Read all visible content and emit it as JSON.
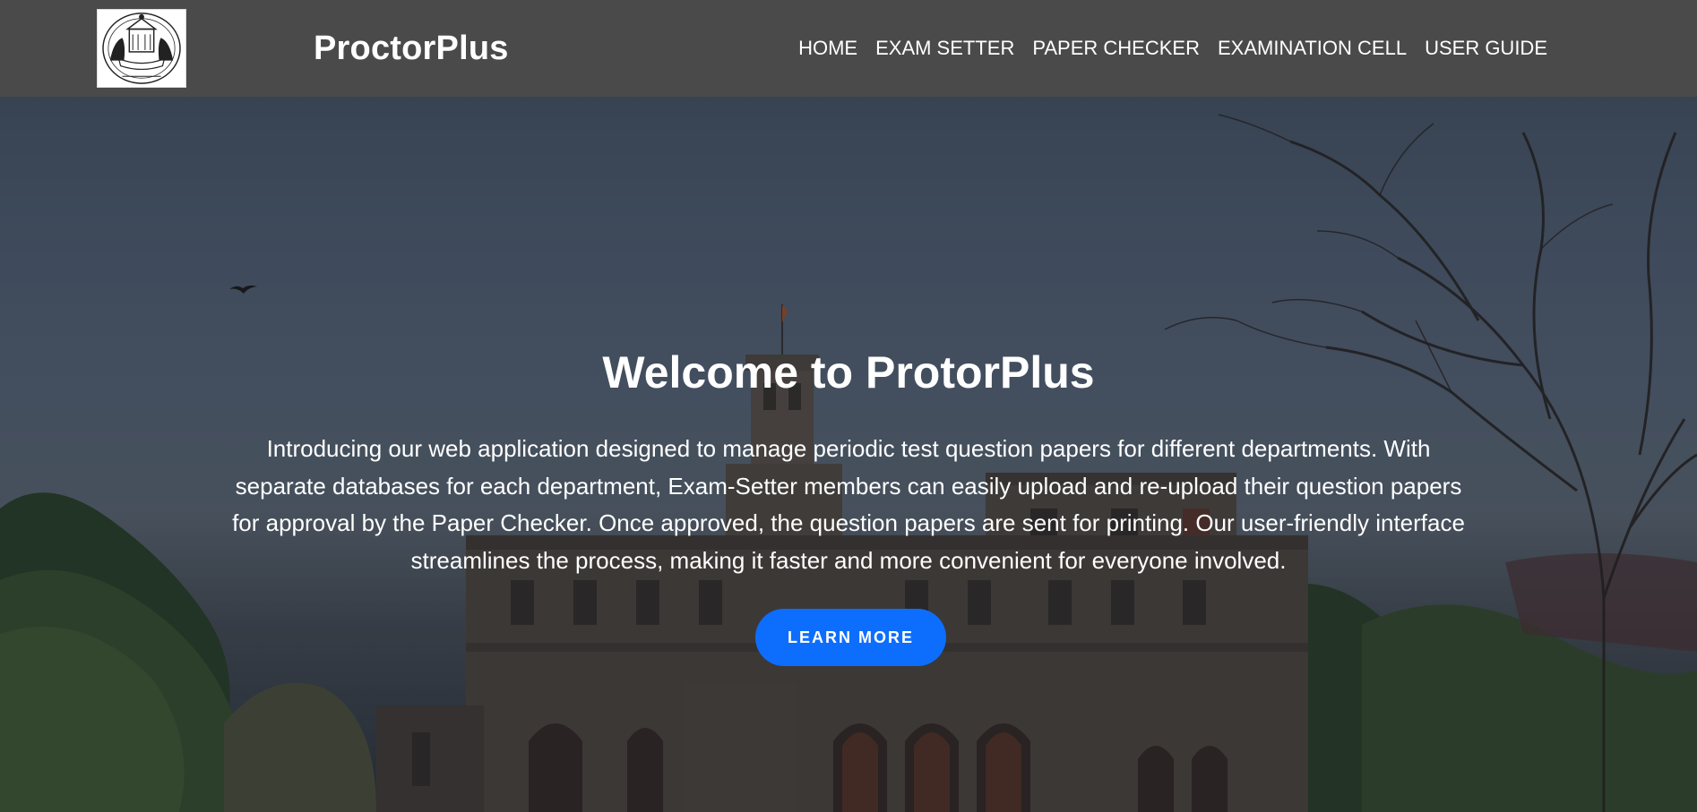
{
  "header": {
    "logo_icon": "university-seal-icon",
    "brand": "ProctorPlus",
    "nav": [
      {
        "label": "HOME"
      },
      {
        "label": "EXAM SETTER"
      },
      {
        "label": "PAPER CHECKER"
      },
      {
        "label": "EXAMINATION CELL"
      },
      {
        "label": "USER GUIDE"
      }
    ],
    "bg_color": "#4a4a4a"
  },
  "hero": {
    "title": "Welcome to ProtorPlus",
    "description": "Introducing our web application designed to manage periodic test question papers for different departments. With separate databases for each department, Exam-Setter members can easily upload and re-upload their question papers for approval by the Paper Checker. Once approved, the question papers are sent for printing. Our user-friendly interface streamlines the process, making it faster and more convenient for everyone involved.",
    "button_label": "LEARN MORE",
    "button_color": "#0d6efd",
    "background_image": "university-building-photo"
  }
}
